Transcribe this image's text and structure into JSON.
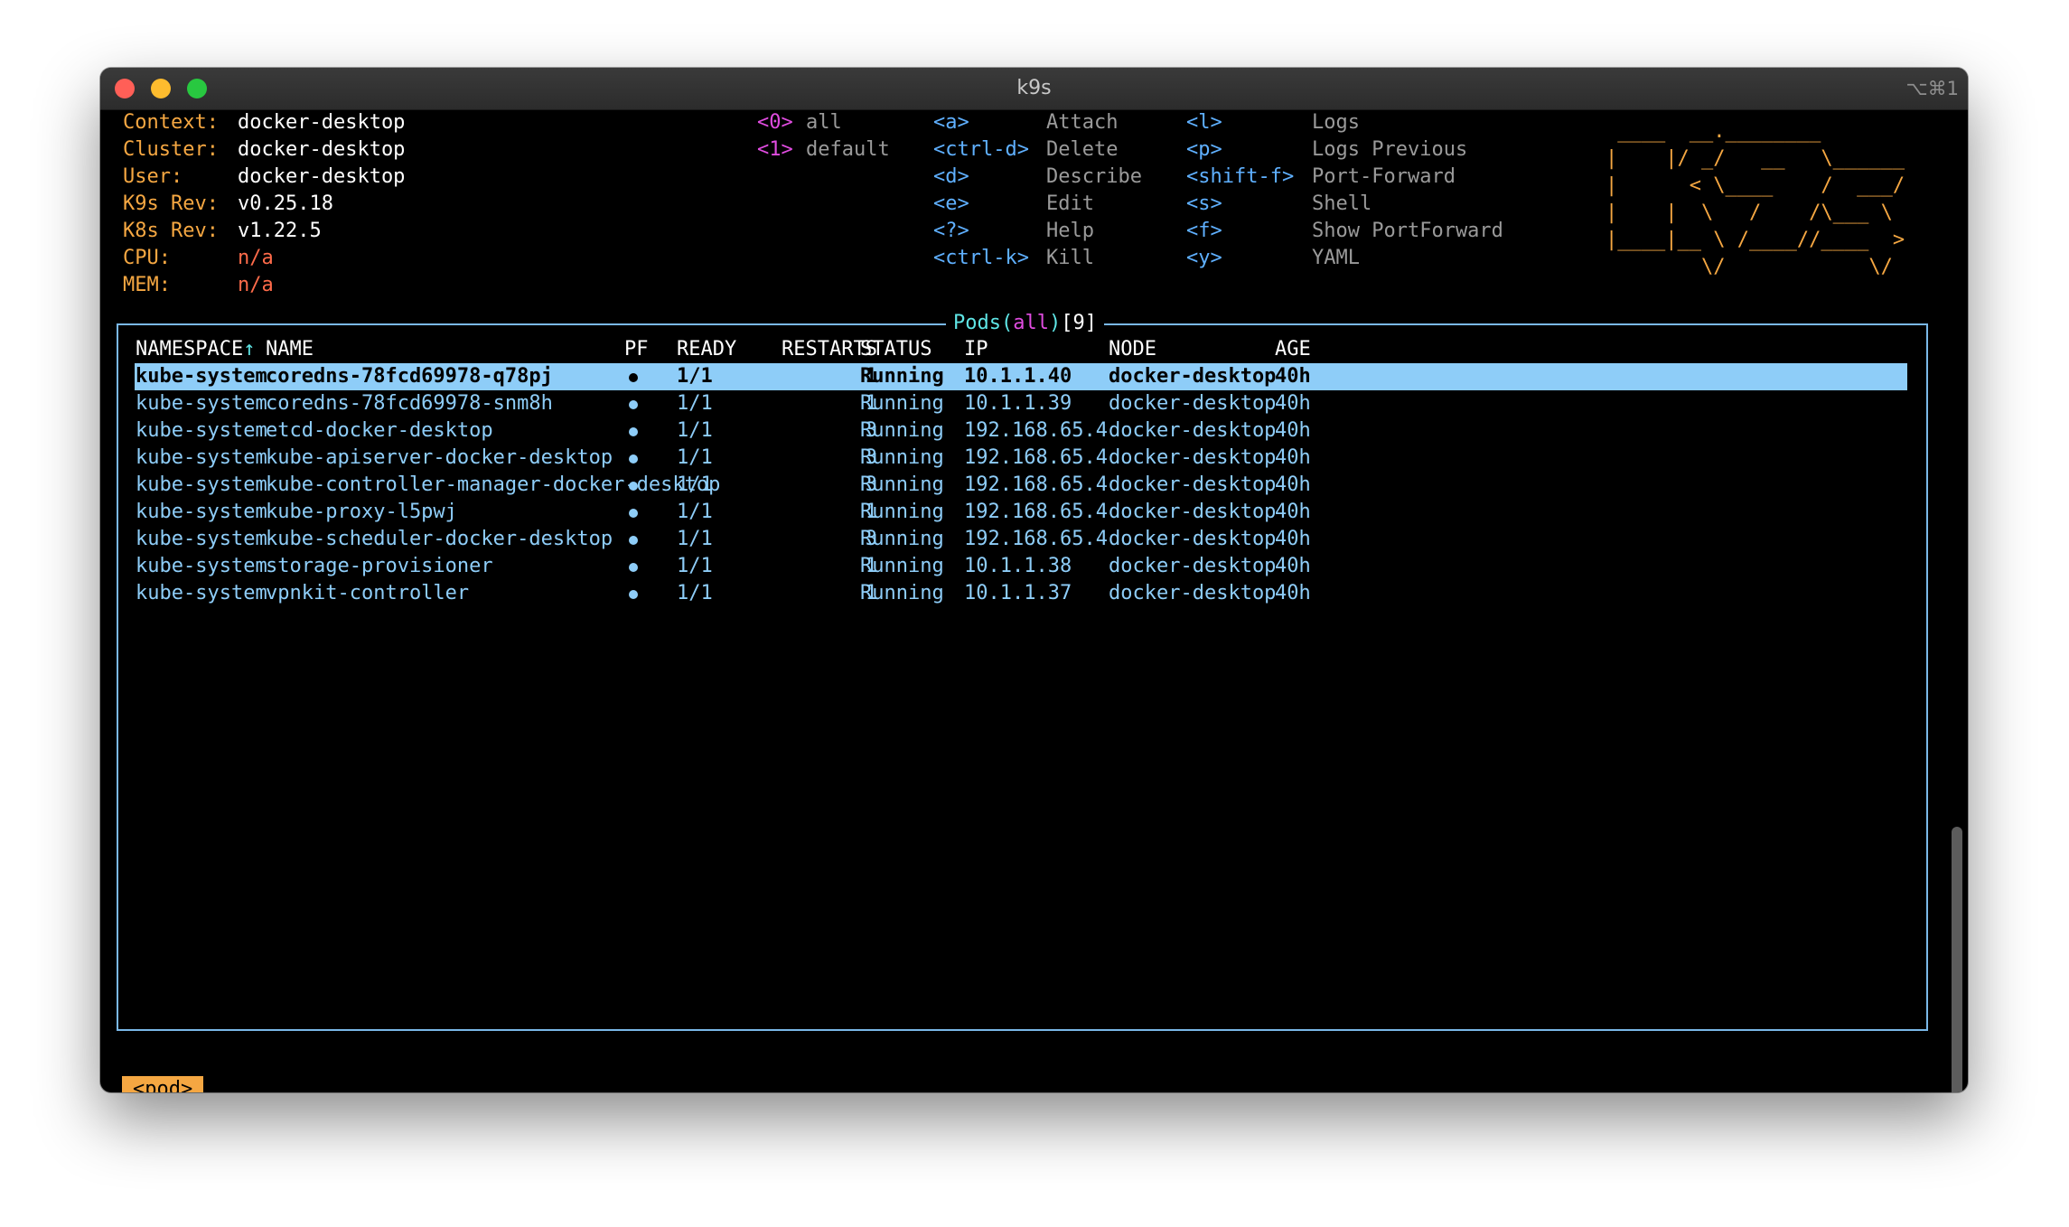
{
  "window": {
    "title": "k9s",
    "shortcut": "⌥⌘1"
  },
  "info": {
    "context_label": "Context:",
    "context_value": "docker-desktop",
    "cluster_label": "Cluster:",
    "cluster_value": "docker-desktop",
    "user_label": "User:",
    "user_value": "docker-desktop",
    "k9s_rev_label": "K9s Rev:",
    "k9s_rev_value": "v0.25.18",
    "k8s_rev_label": "K8s Rev:",
    "k8s_rev_value": "v1.22.5",
    "cpu_label": "CPU:",
    "cpu_value": "n/a",
    "mem_label": "MEM:",
    "mem_value": "n/a"
  },
  "namespaces": [
    {
      "key": "<0>",
      "label": "all"
    },
    {
      "key": "<1>",
      "label": "default"
    }
  ],
  "shortcuts_col1": [
    {
      "key": "<a>",
      "label": "Attach"
    },
    {
      "key": "<ctrl-d>",
      "label": "Delete"
    },
    {
      "key": "<d>",
      "label": "Describe"
    },
    {
      "key": "<e>",
      "label": "Edit"
    },
    {
      "key": "<?>",
      "label": "Help"
    },
    {
      "key": "<ctrl-k>",
      "label": "Kill"
    }
  ],
  "shortcuts_col2": [
    {
      "key": "<l>",
      "label": "Logs"
    },
    {
      "key": "<p>",
      "label": "Logs Previous"
    },
    {
      "key": "<shift-f>",
      "label": "Port-Forward"
    },
    {
      "key": "<s>",
      "label": "Shell"
    },
    {
      "key": "<f>",
      "label": "Show PortForward"
    },
    {
      "key": "<y>",
      "label": "YAML"
    }
  ],
  "logo_ascii": " ____  __.________\n|    |/ _/   __   \\______\n|      < \\____    /  ___/\n|    |  \\   /    /\\___ \\\n|____|__ \\ /____//____  >\n        \\/            \\/",
  "table": {
    "title_resource": "Pods",
    "title_open": "(",
    "title_ns": "all",
    "title_close": ")",
    "title_count": "[9]",
    "sort_arrow": "↑",
    "headers": {
      "namespace": "NAMESPACE",
      "name": "NAME",
      "pf": "PF",
      "ready": "READY",
      "restarts": "RESTARTS",
      "status": "STATUS",
      "ip": "IP",
      "node": "NODE",
      "age": "AGE"
    },
    "rows": [
      {
        "namespace": "kube-system",
        "name": "coredns-78fcd69978-q78pj",
        "ready": "1/1",
        "restarts": "1",
        "status": "Running",
        "ip": "10.1.1.40",
        "node": "docker-desktop",
        "age": "40h"
      },
      {
        "namespace": "kube-system",
        "name": "coredns-78fcd69978-snm8h",
        "ready": "1/1",
        "restarts": "1",
        "status": "Running",
        "ip": "10.1.1.39",
        "node": "docker-desktop",
        "age": "40h"
      },
      {
        "namespace": "kube-system",
        "name": "etcd-docker-desktop",
        "ready": "1/1",
        "restarts": "3",
        "status": "Running",
        "ip": "192.168.65.4",
        "node": "docker-desktop",
        "age": "40h"
      },
      {
        "namespace": "kube-system",
        "name": "kube-apiserver-docker-desktop",
        "ready": "1/1",
        "restarts": "3",
        "status": "Running",
        "ip": "192.168.65.4",
        "node": "docker-desktop",
        "age": "40h"
      },
      {
        "namespace": "kube-system",
        "name": "kube-controller-manager-docker-desktop",
        "ready": "1/1",
        "restarts": "3",
        "status": "Running",
        "ip": "192.168.65.4",
        "node": "docker-desktop",
        "age": "40h"
      },
      {
        "namespace": "kube-system",
        "name": "kube-proxy-l5pwj",
        "ready": "1/1",
        "restarts": "1",
        "status": "Running",
        "ip": "192.168.65.4",
        "node": "docker-desktop",
        "age": "40h"
      },
      {
        "namespace": "kube-system",
        "name": "kube-scheduler-docker-desktop",
        "ready": "1/1",
        "restarts": "3",
        "status": "Running",
        "ip": "192.168.65.4",
        "node": "docker-desktop",
        "age": "40h"
      },
      {
        "namespace": "kube-system",
        "name": "storage-provisioner",
        "ready": "1/1",
        "restarts": "1",
        "status": "Running",
        "ip": "10.1.1.38",
        "node": "docker-desktop",
        "age": "40h"
      },
      {
        "namespace": "kube-system",
        "name": "vpnkit-controller",
        "ready": "1/1",
        "restarts": "1",
        "status": "Running",
        "ip": "10.1.1.37",
        "node": "docker-desktop",
        "age": "40h"
      }
    ]
  },
  "breadcrumb": "<pod>"
}
